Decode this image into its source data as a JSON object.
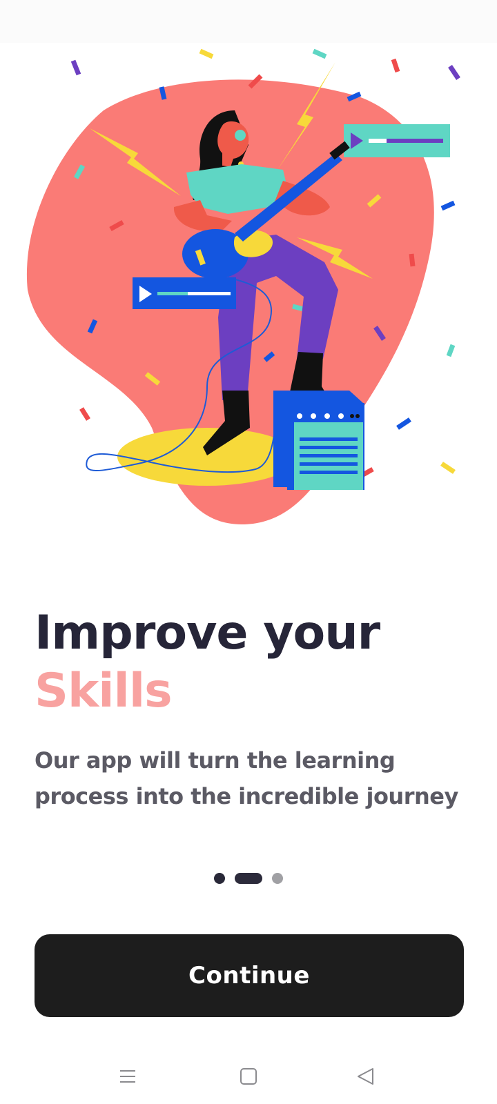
{
  "onboarding": {
    "title_line1": "Improve your",
    "title_line2": "Skills",
    "subtitle": "Our app will turn the learning process into the incredible journey",
    "continue_label": "Continue",
    "page_count": 3,
    "current_page": 2
  },
  "colors": {
    "title": "#262538",
    "accent": "#f8a2a0",
    "button_bg": "#1d1d1d",
    "blob": "#fa7b76"
  },
  "icons": {
    "nav_menu": "menu-icon",
    "nav_home": "square-home-icon",
    "nav_back": "triangle-back-icon"
  }
}
